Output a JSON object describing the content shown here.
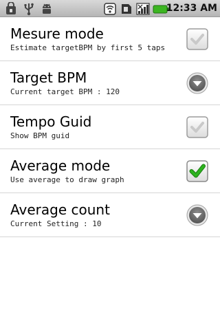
{
  "status_bar": {
    "left_icons": [
      "lock-bag-icon",
      "usb-icon",
      "android-debug-icon"
    ],
    "right_icons": [
      "wifi-icon",
      "sim-card-icon",
      "signal-bars-icon",
      "battery-icon"
    ],
    "time": "12:33 AM",
    "battery_color": "#3cb521"
  },
  "settings": {
    "items": [
      {
        "title": "Mesure mode",
        "summary": "Estimate targetBPM by first 5 taps",
        "widget": "checkbox",
        "checked": false
      },
      {
        "title": "Target BPM",
        "summary": "Current target BPM : 120",
        "widget": "dropdown-arrow-icon"
      },
      {
        "title": "Tempo Guid",
        "summary": "Show BPM guid",
        "widget": "checkbox",
        "checked": false
      },
      {
        "title": "Average mode",
        "summary": "Use average to draw graph",
        "widget": "checkbox",
        "checked": true
      },
      {
        "title": "Average count",
        "summary": "Current Setting : 10",
        "widget": "dropdown-arrow-icon"
      }
    ]
  },
  "colors": {
    "checkmark_on": "#2db31f",
    "checkmark_off": "#c9c9c9",
    "divider": "#d6d6d6"
  }
}
